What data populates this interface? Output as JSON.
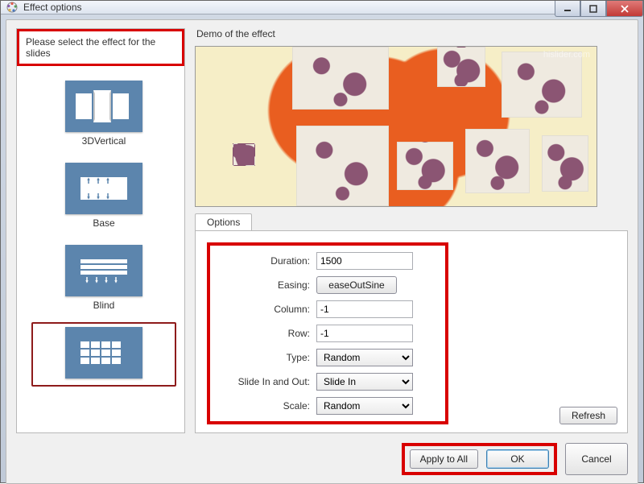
{
  "window": {
    "title": "Effect options"
  },
  "left": {
    "header": "Please select the effect for the slides",
    "items": [
      {
        "name": "3DVertical",
        "thumb": "3dvertical"
      },
      {
        "name": "Base",
        "thumb": "base"
      },
      {
        "name": "Blind",
        "thumb": "blind"
      },
      {
        "name": "",
        "thumb": "grid"
      }
    ],
    "selected_index": 3
  },
  "preview": {
    "label": "Demo of the effect",
    "watermark": "hislider.com"
  },
  "options": {
    "tab_label": "Options",
    "fields": {
      "duration_label": "Duration:",
      "duration_value": "1500",
      "easing_label": "Easing:",
      "easing_value": "easeOutSine",
      "column_label": "Column:",
      "column_value": "-1",
      "row_label": "Row:",
      "row_value": "-1",
      "type_label": "Type:",
      "type_value": "Random",
      "slide_label": "Slide In and Out:",
      "slide_value": "Slide In",
      "scale_label": "Scale:",
      "scale_value": "Random"
    },
    "refresh_label": "Refresh"
  },
  "footer": {
    "apply_all": "Apply to All",
    "ok": "OK",
    "cancel": "Cancel"
  }
}
